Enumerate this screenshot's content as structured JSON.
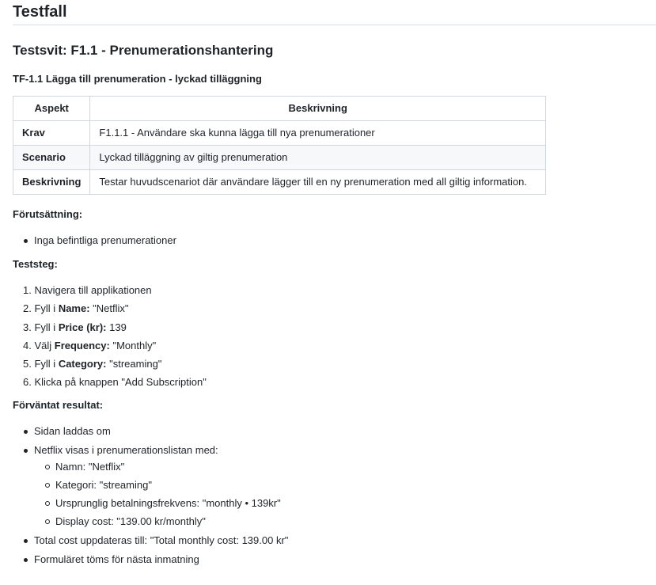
{
  "title": "Testfall",
  "suite_title": "Testsvit: F1.1 - Prenumerationshantering",
  "case_title": "TF-1.1 Lägga till prenumeration - lyckad tilläggning",
  "table": {
    "headers": [
      "Aspekt",
      "Beskrivning"
    ],
    "rows": [
      {
        "aspect": "Krav",
        "description": "F1.1.1 - Användare ska kunna lägga till nya prenumerationer"
      },
      {
        "aspect": "Scenario",
        "description": "Lyckad tilläggning av giltig prenumeration"
      },
      {
        "aspect": "Beskrivning",
        "description": "Testar huvudscenariot där användare lägger till en ny prenumeration med all giltig information."
      }
    ]
  },
  "preconditions": {
    "label": "Förutsättning:",
    "items": [
      "Inga befintliga prenumerationer"
    ]
  },
  "steps": {
    "label": "Teststeg:",
    "items": [
      {
        "num": "1.",
        "pre": "Navigera till applikationen",
        "bold": "",
        "post": ""
      },
      {
        "num": "2.",
        "pre": "Fyll i ",
        "bold": "Name:",
        "post": " \"Netflix\""
      },
      {
        "num": "3.",
        "pre": "Fyll i ",
        "bold": "Price (kr):",
        "post": " 139"
      },
      {
        "num": "4.",
        "pre": "Välj ",
        "bold": "Frequency:",
        "post": " \"Monthly\""
      },
      {
        "num": "5.",
        "pre": "Fyll i ",
        "bold": "Category:",
        "post": " \"streaming\""
      },
      {
        "num": "6.",
        "pre": "Klicka på knappen \"Add Subscription\"",
        "bold": "",
        "post": ""
      }
    ]
  },
  "expected": {
    "label": "Förväntat resultat:",
    "item1": "Sidan laddas om",
    "item2": "Netflix visas i prenumerationslistan med:",
    "sub_items": [
      "Namn: \"Netflix\"",
      "Kategori: \"streaming\"",
      "Ursprunglig betalningsfrekvens: \"monthly • 139kr\"",
      "Display cost: \"139.00 kr/monthly\""
    ],
    "item3": "Total cost uppdateras till: \"Total monthly cost: 139.00 kr\"",
    "item4": "Formuläret töms för nästa inmatning"
  }
}
